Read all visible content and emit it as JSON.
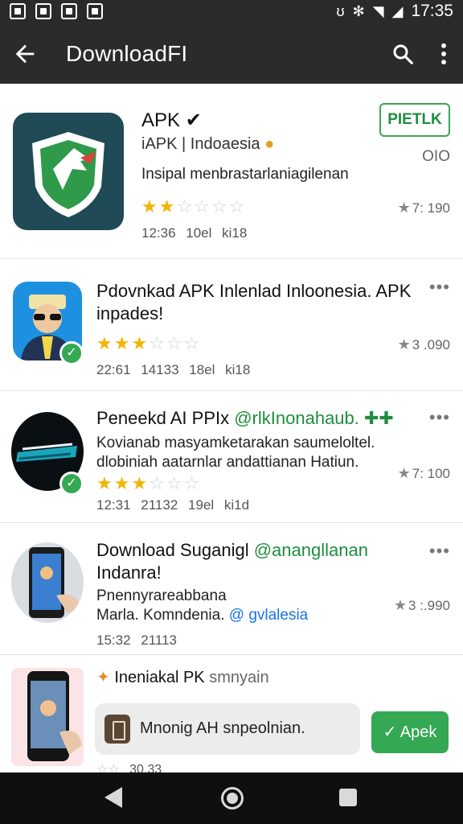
{
  "status_bar": {
    "time": "17:35",
    "glyphs": [
      "ʊ",
      "✻",
      "◥",
      "◢"
    ]
  },
  "app_bar": {
    "title": "DownloadFI",
    "back_icon": "arrow-left-icon",
    "search_icon": "search-icon",
    "more_icon": "more-vert-icon"
  },
  "colors": {
    "bar_bg": "#2b2b2b",
    "accent_green": "#34a853",
    "star_yellow": "#f4b400",
    "link_blue": "#1a73e8"
  },
  "items": [
    {
      "title": "APK",
      "title_suffix": "✔",
      "subtitle": "iAPK | Indoaesia",
      "subtitle_badge": "●",
      "right_label": "OIO",
      "desc": "Insipal menbrastarlaniagilenan",
      "rating_stars": 2,
      "count": "7: 190",
      "meta": "12:36 10el ki18",
      "button_label": "PIETLK"
    },
    {
      "title": "Pdovnkad APK Inlenlad Inloonesia. APK",
      "title_line2": "inpades!",
      "rating_stars": 3,
      "count": "3 .090",
      "meta": "22:61 14133 18el ki18",
      "overflow": "•••"
    },
    {
      "title": "Peneekd AI PPIx",
      "title_green": "@rlkInonahaub. ✚✚",
      "desc_line1": "Kovianab masyamketarakan saumeloltel.",
      "desc_line2": "dlobiniah aatarnlar andattianan Hatiun.",
      "rating_stars": 3,
      "count": "7: 100",
      "meta": "12:31 21132 19el ki1d",
      "overflow": "•••"
    },
    {
      "title": "Download Suganigl",
      "title_green": "@anangllanan",
      "title_line2": "Indanra!",
      "desc_line1": "Pnennyrareabbana",
      "desc_line2": "Marla. Komndenia.",
      "desc_blue": "@ gvlalesia",
      "count": "3 :.990",
      "meta": "15:32 21113",
      "overflow": "•••"
    },
    {
      "title_prefix_icon": "puzzle-icon",
      "title": "Ineniakal PK",
      "title_gray": "smnyain",
      "promo_text": "Mnonig AH snpeolnian.",
      "apk_button": "✓ Apek",
      "meta": "30.33"
    }
  ],
  "nav_bar": {
    "back": "nav-back-icon",
    "home": "nav-home-icon",
    "recents": "nav-recents-icon"
  }
}
